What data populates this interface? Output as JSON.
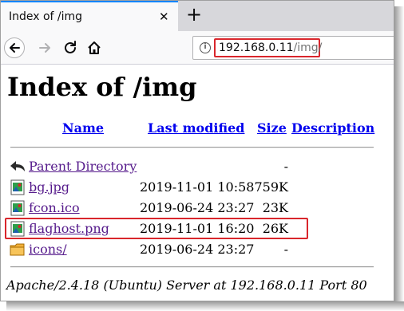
{
  "browser": {
    "tab_title": "Index of /img",
    "tab_close": "✕",
    "new_tab": "+",
    "url_host": "192.168.0.11",
    "url_path": "/img/"
  },
  "page": {
    "title": "Index of /img",
    "columns": {
      "name": "Name",
      "last_modified": "Last modified",
      "size": "Size",
      "description": "Description"
    },
    "entries": [
      {
        "name": "Parent Directory",
        "date": "",
        "size": "-",
        "icon": "back-arrow-icon"
      },
      {
        "name": "bg.jpg",
        "date": "2019-11-01 10:58",
        "size": "759K",
        "icon": "image-file-icon"
      },
      {
        "name": "fcon.ico",
        "date": "2019-06-24 23:27",
        "size": "23K",
        "icon": "image-file-icon"
      },
      {
        "name": "flaghost.png",
        "date": "2019-11-01 16:20",
        "size": "26K",
        "icon": "image-file-icon"
      },
      {
        "name": "icons/",
        "date": "2019-06-24 23:27",
        "size": "-",
        "icon": "folder-icon"
      }
    ],
    "footer": "Apache/2.4.18 (Ubuntu) Server at 192.168.0.11 Port 80"
  },
  "colors": {
    "highlight": "#d9262c",
    "link": "#0000ee",
    "visited_link": "#551a8b",
    "tab_accent": "#0a84ff"
  }
}
